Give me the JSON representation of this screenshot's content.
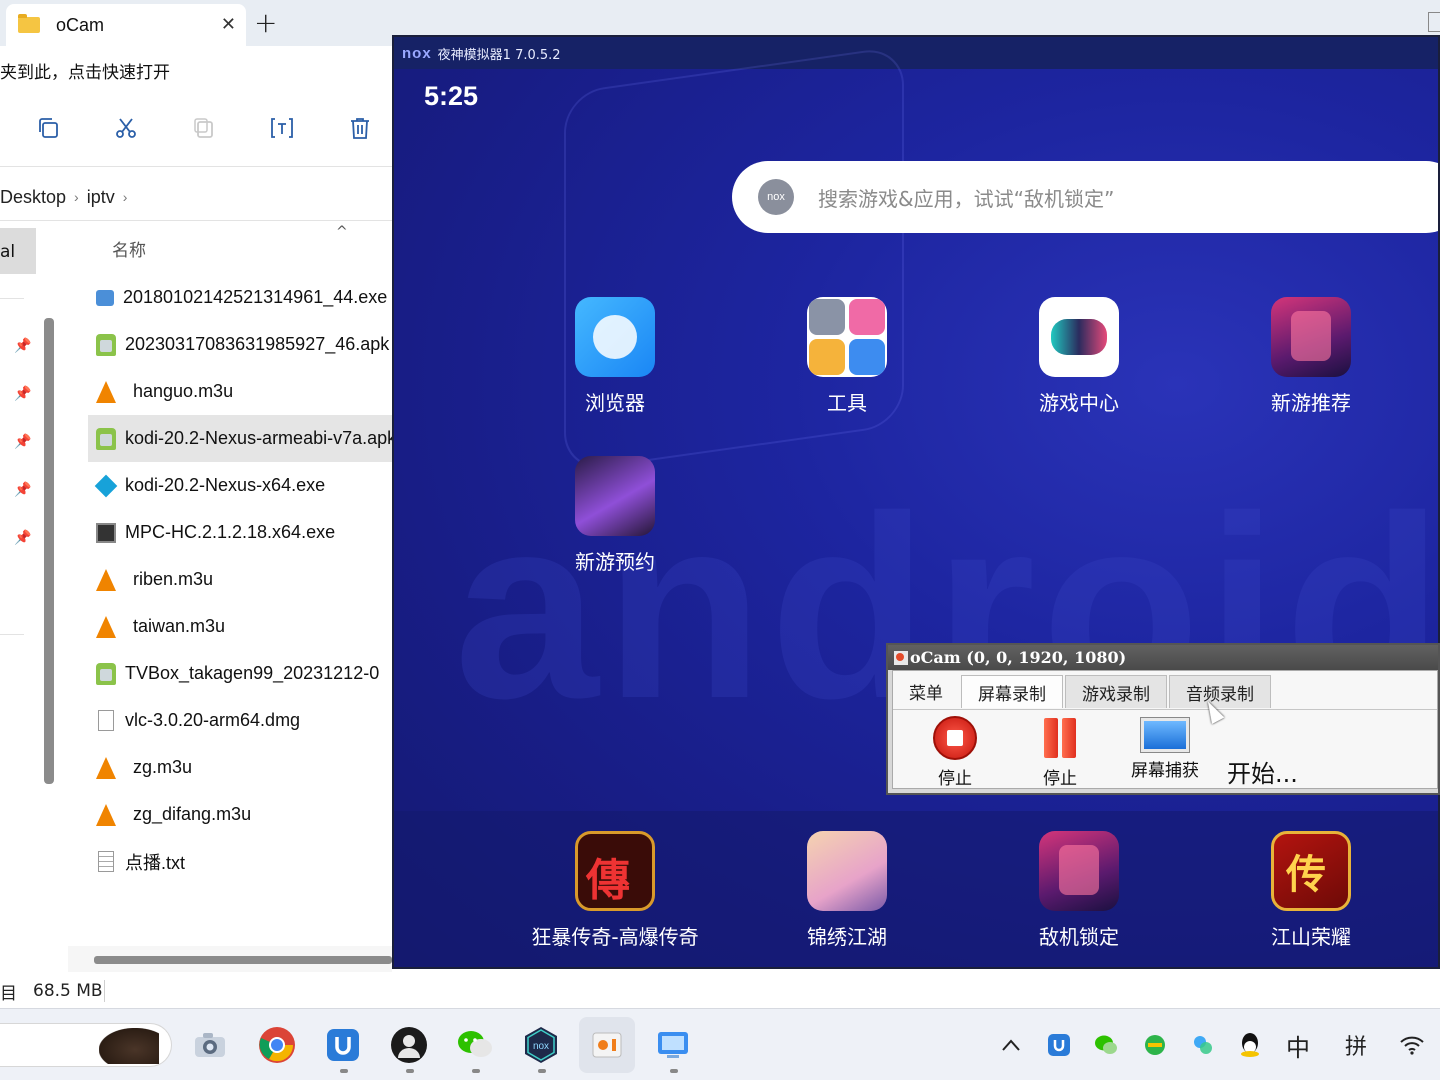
{
  "explorer": {
    "tab_title": "oCam",
    "tab_close": "✕",
    "new_tab": "+",
    "address_hint": "夹到此，点击快速打开",
    "breadcrumb": [
      "Desktop",
      "iptv"
    ],
    "breadcrumb_sep": "›",
    "nav_selected": "al",
    "column_name": "名称",
    "sort_arrow": "^",
    "files": [
      {
        "name": "20180102142521314961_44.exe",
        "icon": "exe-tv-icon"
      },
      {
        "name": "20230317083631985927_46.apk",
        "icon": "apk-icon"
      },
      {
        "name": "hanguo.m3u",
        "icon": "vlc-icon"
      },
      {
        "name": "kodi-20.2-Nexus-armeabi-v7a.apk",
        "icon": "apk-icon",
        "selected": true
      },
      {
        "name": "kodi-20.2-Nexus-x64.exe",
        "icon": "kodi-icon"
      },
      {
        "name": "MPC-HC.2.1.2.18.x64.exe",
        "icon": "mpc-icon"
      },
      {
        "name": "riben.m3u",
        "icon": "vlc-icon"
      },
      {
        "name": "taiwan.m3u",
        "icon": "vlc-icon"
      },
      {
        "name": "TVBox_takagen99_20231212-0",
        "icon": "apk-icon"
      },
      {
        "name": "vlc-3.0.20-arm64.dmg",
        "icon": "document-icon"
      },
      {
        "name": "zg.m3u",
        "icon": "vlc-icon"
      },
      {
        "name": "zg_difang.m3u",
        "icon": "vlc-icon"
      },
      {
        "name": "点播.txt",
        "icon": "text-file-icon"
      }
    ],
    "status_left": "目",
    "status_size": "68.5 MB"
  },
  "nox": {
    "logo": "nox",
    "title": "夜神模拟器1 7.0.5.2",
    "clock": "5:25",
    "bg_watermark": "android",
    "search_logo": "nox",
    "search_placeholder": "搜索游戏&应用，试试“敌机锁定”",
    "apps": [
      {
        "label": "浏览器"
      },
      {
        "label": "工具"
      },
      {
        "label": "游戏中心"
      },
      {
        "label": "新游推荐"
      },
      {
        "label": "新游预约"
      }
    ],
    "dock": [
      {
        "label": "狂暴传奇-高爆传奇",
        "glyph": "傳"
      },
      {
        "label": "锦绣江湖"
      },
      {
        "label": "敌机锁定"
      },
      {
        "label": "江山荣耀",
        "glyph": "传"
      }
    ]
  },
  "ocam": {
    "title": "oCam (0, 0, 1920, 1080)",
    "tabs": [
      "菜单",
      "屏幕录制",
      "游戏录制",
      "音频录制"
    ],
    "active_tab": "屏幕录制",
    "tools": [
      "停止",
      "停止",
      "屏幕捕获"
    ],
    "status": "开始..."
  },
  "taskbar": {
    "apps": [
      "camera-icon",
      "chrome-icon",
      "bluetooth-app-icon",
      "avatar-app-icon",
      "wechat-icon",
      "nox-icon",
      "ocam-icon",
      "files-icon"
    ],
    "tray": {
      "chevron": "^",
      "ime_lang": "中",
      "ime_mode": "拼"
    }
  },
  "colors": {
    "nox_bg": "#1d25a0",
    "accent_blue": "#2066c8",
    "ocam_stop_red": "#e0301f"
  }
}
